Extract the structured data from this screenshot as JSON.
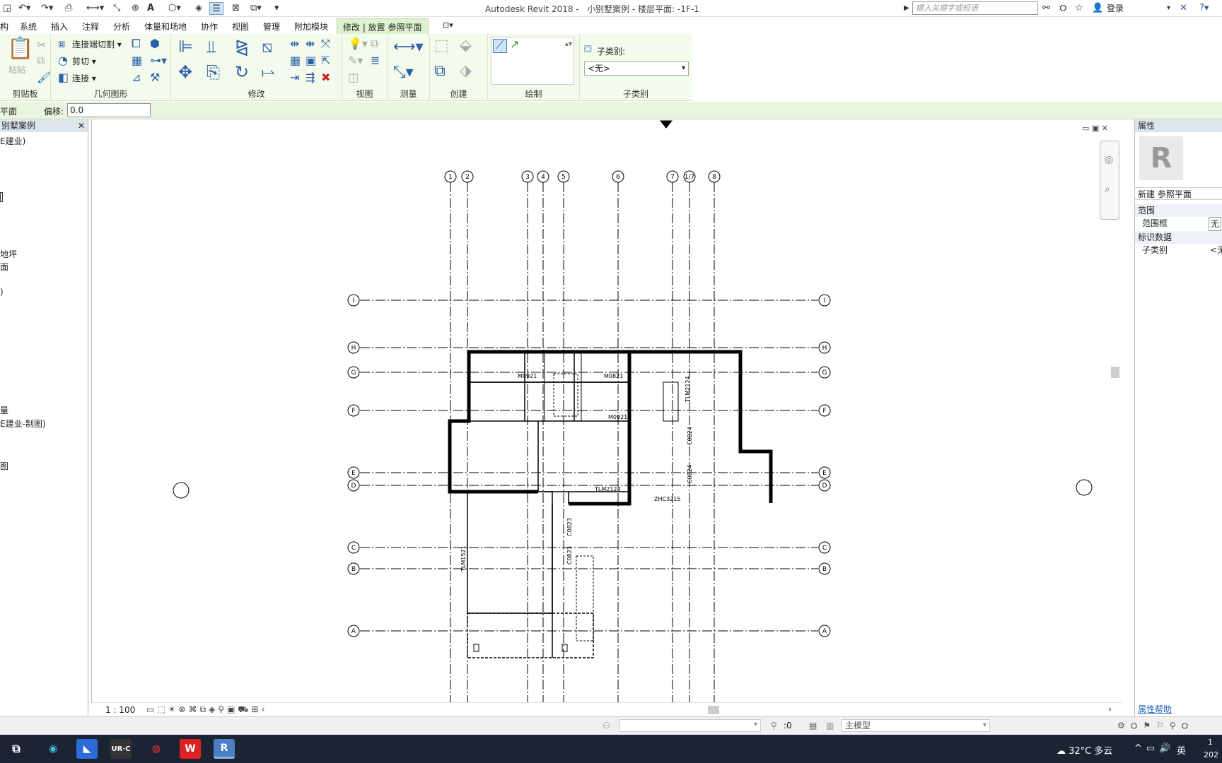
{
  "title_bar": {
    "app_title": "Autodesk Revit 2018 -",
    "doc_title": "小别墅案例 - 楼层平面: -1F-1",
    "search_placeholder": "键入关键字或短语",
    "login_label": "登录"
  },
  "menu": {
    "tabs": [
      "构",
      "系统",
      "插入",
      "注释",
      "分析",
      "体量和场地",
      "协作",
      "视图",
      "管理",
      "附加模块",
      "修改 | 放置 参照平面"
    ]
  },
  "ribbon": {
    "clipboard": {
      "paste_label": "粘贴",
      "group_title": "剪贴板"
    },
    "geometry": {
      "join_cut_label": "连接端切割",
      "cut_label": "剪切",
      "join_label": "连接",
      "group_title": "几何图形"
    },
    "modify": {
      "group_title": "修改"
    },
    "view": {
      "group_title": "视图"
    },
    "measure": {
      "group_title": "测量"
    },
    "create": {
      "group_title": "创建"
    },
    "draw": {
      "group_title": "绘制"
    },
    "subcategory": {
      "label": "子类别:",
      "value": "<无>",
      "group_title": "子类别"
    }
  },
  "options_bar": {
    "context_label": "平面",
    "offset_label": "偏移:",
    "offset_value": "0.0"
  },
  "project_browser": {
    "title": "别墅案例",
    "items": [
      "E建业)",
      "地坪",
      "面",
      "量",
      "E建业-制图)",
      "图"
    ]
  },
  "view_bar": {
    "scale": "1 : 100"
  },
  "properties": {
    "title": "属性",
    "type_name": "新建 参照平面",
    "section_extent": "范围",
    "scope_box_label": "范围框",
    "scope_box_value": "无",
    "section_identity": "标识数据",
    "subcategory_label": "子类别",
    "subcategory_value": "<无",
    "help_link": "属性帮助"
  },
  "status_bar": {
    "selection_count": ":0",
    "model_label": "主模型"
  },
  "taskbar": {
    "weather": "32°C 多云",
    "ime": "英",
    "clock_top": "1",
    "clock_bottom": "202"
  },
  "drawing": {
    "grid_vertical_labels": [
      "1",
      "2",
      "3",
      "4",
      "5",
      "6",
      "7",
      "1/7",
      "8"
    ],
    "grid_horizontal_labels": [
      "I",
      "H",
      "G",
      "F",
      "E",
      "D",
      "C",
      "B",
      "A"
    ],
    "door_window_tags": [
      "M0921",
      "M0821",
      "M0921",
      "TLM2124",
      "ZHC3215",
      "C0824",
      "C0824",
      "C0823",
      "C0823",
      "TLM2124",
      "TLM1521"
    ]
  }
}
